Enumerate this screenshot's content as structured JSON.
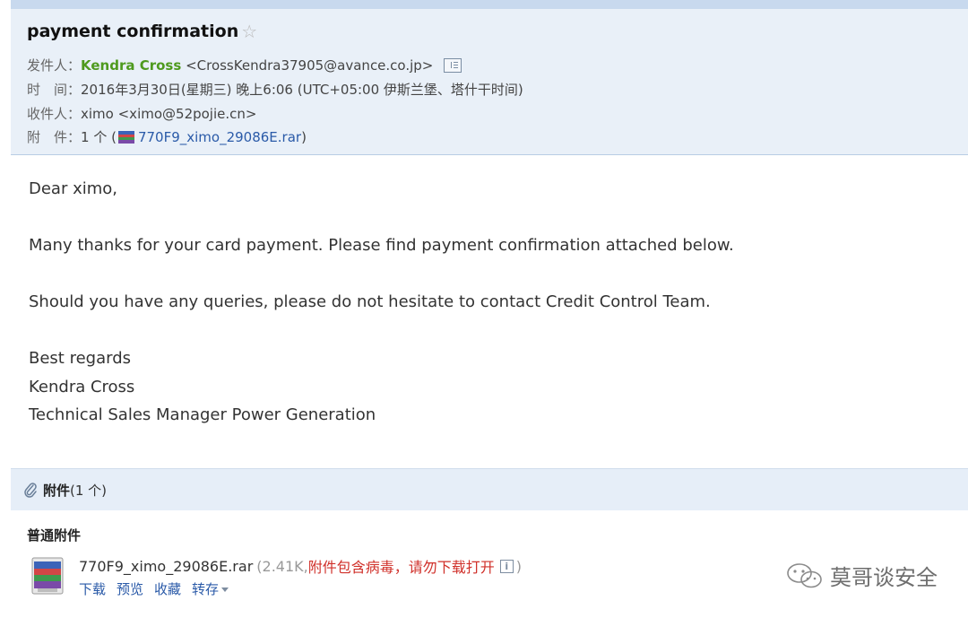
{
  "email": {
    "subject": "payment confirmation",
    "star_glyph": "☆",
    "from_label": "发件人：",
    "from_name": "Kendra Cross",
    "from_email": "<CrossKendra37905@avance.co.jp>",
    "time_label": "时　间：",
    "time_value": "2016年3月30日(星期三) 晚上6:06 (UTC+05:00 伊斯兰堡、塔什干时间)",
    "to_label": "收件人：",
    "to_value": "ximo <ximo@52pojie.cn>",
    "attach_label": "附　件：",
    "attach_count": "1 个 (",
    "attach_file": "770F9_ximo_29086E.rar",
    "attach_close": ")"
  },
  "body": {
    "greeting": "Dear ximo,",
    "line1": "Many thanks for your card payment. Please find payment confirmation attached below.",
    "line2": "Should you have any queries, please do not hesitate to contact Credit Control Team.",
    "closing": "Best regards",
    "sig_name": "Kendra Cross",
    "sig_title": "Technical Sales Manager Power Generation"
  },
  "attachments": {
    "header_title": "附件",
    "header_count": "(1 个)",
    "section_title": "普通附件",
    "file_name": "770F9_ximo_29086E.rar",
    "size_open": "(2.41K, ",
    "virus_warning": "附件包含病毒，请勿下载打开",
    "size_close": ")",
    "info_glyph": "i",
    "actions": [
      "下载",
      "预览",
      "收藏",
      "转存"
    ]
  },
  "watermark": {
    "text": "莫哥谈安全"
  },
  "icons": {
    "star": "star-icon",
    "contact_card": "contact-card-icon",
    "rar": "rar-archive-icon",
    "paperclip": "paperclip-icon",
    "info": "info-icon",
    "dropdown": "chevron-down-icon",
    "wechat": "wechat-icon"
  },
  "colors": {
    "header_bg": "#e9f0f8",
    "sender_green": "#4e9a1e",
    "link_blue": "#2a5aa8",
    "warning_red": "#d0302a"
  }
}
